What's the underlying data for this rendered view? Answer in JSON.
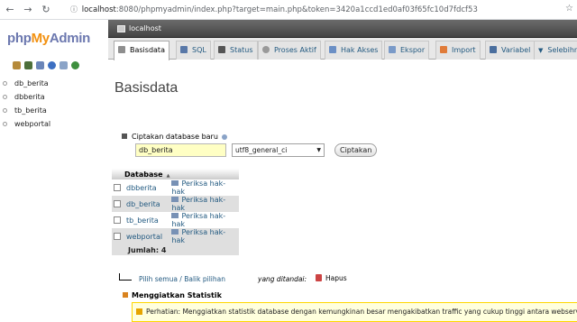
{
  "browser": {
    "url_host": "localhost",
    "url_rest": ":8080/phpmyadmin/index.php?target=main.php&token=3420a1ccd1ed0af03f65fc10d7fdcf53"
  },
  "logo": {
    "php": "php",
    "my": "My",
    "admin": "Admin"
  },
  "sidebar": {
    "databases": [
      "db_berita",
      "dbberita",
      "tb_berita",
      "webportal"
    ]
  },
  "server": {
    "label": "localhost"
  },
  "tabs": [
    {
      "label": "Basisdata",
      "active": true,
      "color": "#8e8e8e"
    },
    {
      "label": "SQL",
      "color": "#5978a8"
    },
    {
      "label": "Status",
      "color": "#555"
    },
    {
      "label": "Proses Aktif",
      "color": "#999"
    },
    {
      "label": "Hak Akses",
      "color": "#6b8fc5"
    },
    {
      "label": "Ekspor",
      "color": "#7a9ac8"
    },
    {
      "label": "Import",
      "color": "#e07b39"
    },
    {
      "label": "Variabel",
      "color": "#4a6e9e"
    },
    {
      "label": "Selebihnya",
      "color": "#222"
    }
  ],
  "main": {
    "title": "Basisdata",
    "create_label": "Ciptakan database baru",
    "dbname_value": "db_berita",
    "collation_value": "utf8_general_ci",
    "create_button": "Ciptakan",
    "table_header": "Database",
    "priv_label": "Periksa hak-hak",
    "rows": [
      {
        "name": "dbberita"
      },
      {
        "name": "db_berita"
      },
      {
        "name": "tb_berita"
      },
      {
        "name": "webportal"
      }
    ],
    "total": "Jumlah: 4",
    "select_all": "Pilih semua / Balik pilihan",
    "with_selected": "yang ditandai:",
    "drop": "Hapus",
    "stats_label": "Menggiatkan Statistik",
    "notice": "Perhatian: Menggiatkan statistik database dengan kemungkinan besar mengakibatkan traffic yang cukup tinggi antara webserver dan server"
  },
  "colors": {
    "accent": "#235a81",
    "input_bg": "#ffffc4",
    "notice_bg": "#ffffdd"
  }
}
